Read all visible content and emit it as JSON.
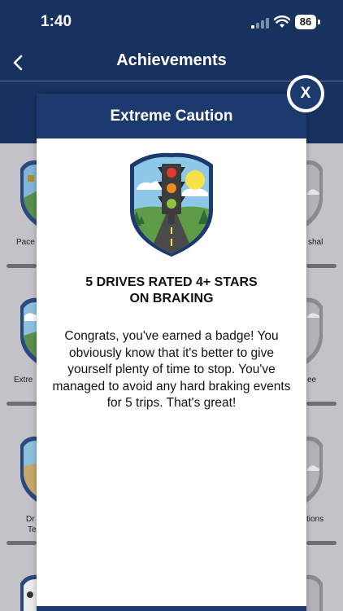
{
  "status_bar": {
    "time": "1:40",
    "battery": "86"
  },
  "nav": {
    "title": "Achievements",
    "back_icon": "chevron-left-icon"
  },
  "background_tiles": {
    "left_labels": [
      "Pace",
      "Extre",
      "Dr",
      "Te"
    ],
    "right_labels": [
      "shal",
      "ee",
      "tions"
    ]
  },
  "modal": {
    "title": "Extreme Caution",
    "close_label": "X",
    "badge_icon": "traffic-light-badge-icon",
    "headline": "5 DRIVES RATED 4+ STARS ON BRAKING",
    "headline_lines": [
      "5 DRIVES RATED 4+ STARS",
      "ON BRAKING"
    ],
    "description": "Congrats, you've earned a badge!  You obviously know that it's better to give yourself plenty of time to stop. You've managed to avoid any hard braking events for 5 trips.  That's great!"
  },
  "colors": {
    "navy": "#17325f",
    "modal_header": "#1d3a6e",
    "grey_bg": "#c3c2c8"
  }
}
